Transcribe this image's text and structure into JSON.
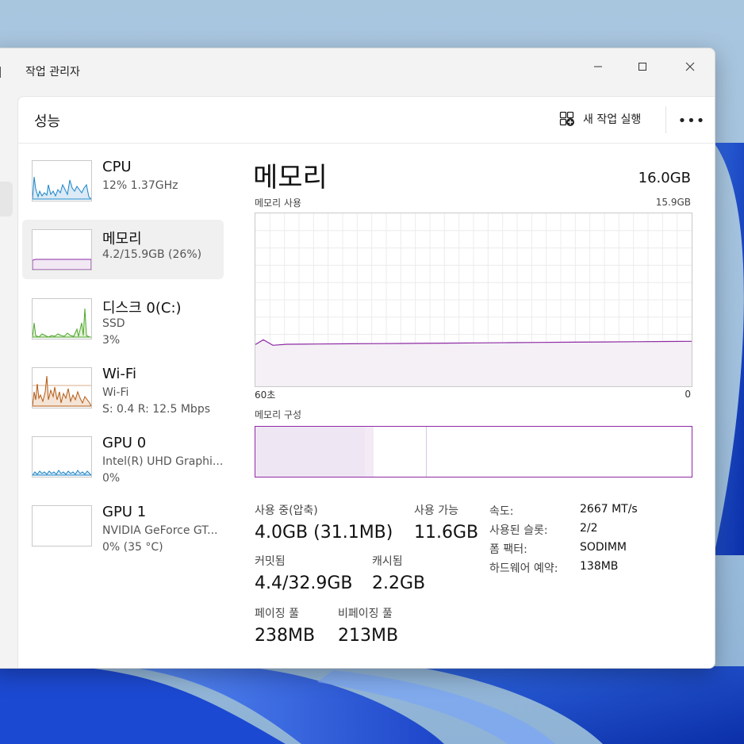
{
  "window": {
    "title": "작업 관리자"
  },
  "header": {
    "page_title": "성능",
    "run_task_label": "새 작업 실행",
    "more_label": "•••"
  },
  "sidebar": {
    "items": [
      {
        "name": "CPU",
        "sub1": "12%  1.37GHz",
        "sub2": "",
        "color": "#1a84c7",
        "selected": false
      },
      {
        "name": "메모리",
        "sub1": "4.2/15.9GB (26%)",
        "sub2": "",
        "color": "#8e2aa3",
        "selected": true
      },
      {
        "name": "디스크 0(C:)",
        "sub1": "SSD",
        "sub2": "3%",
        "color": "#4da62a",
        "selected": false
      },
      {
        "name": "Wi-Fi",
        "sub1": "Wi-Fi",
        "sub2": "S: 0.4  R: 12.5 Mbps",
        "color": "#b45a12",
        "selected": false
      },
      {
        "name": "GPU 0",
        "sub1": "Intel(R) UHD Graphi...",
        "sub2": "0%",
        "color": "#1a84c7",
        "selected": false
      },
      {
        "name": "GPU 1",
        "sub1": "NVIDIA GeForce GT...",
        "sub2": "0% (35 °C)",
        "color": "#1a84c7",
        "selected": false
      }
    ]
  },
  "detail": {
    "title": "메모리",
    "total": "16.0GB",
    "usage_label": "메모리 사용",
    "usage_max": "15.9GB",
    "axis_left": "60초",
    "axis_right": "0",
    "composition_label": "메모리 구성",
    "stats": {
      "in_use_label": "사용 중(압축)",
      "in_use_value": "4.0GB (31.1MB)",
      "available_label": "사용 가능",
      "available_value": "11.6GB",
      "committed_label": "커밋됨",
      "committed_value": "4.4/32.9GB",
      "cached_label": "캐시됨",
      "cached_value": "2.2GB",
      "paged_label": "페이징 풀",
      "paged_value": "238MB",
      "nonpaged_label": "비페이징 풀",
      "nonpaged_value": "213MB"
    },
    "props": [
      {
        "k": "속도:",
        "v": "2667 MT/s"
      },
      {
        "k": "사용된 슬롯:",
        "v": "2/2"
      },
      {
        "k": "폼 팩터:",
        "v": "SODIMM"
      },
      {
        "k": "하드웨어 예약:",
        "v": "138MB"
      }
    ],
    "usage_fraction": 0.26,
    "composition": {
      "in_use_fraction": 0.25,
      "modified_fraction": 0.02,
      "standby_fraction": 0.12
    }
  }
}
